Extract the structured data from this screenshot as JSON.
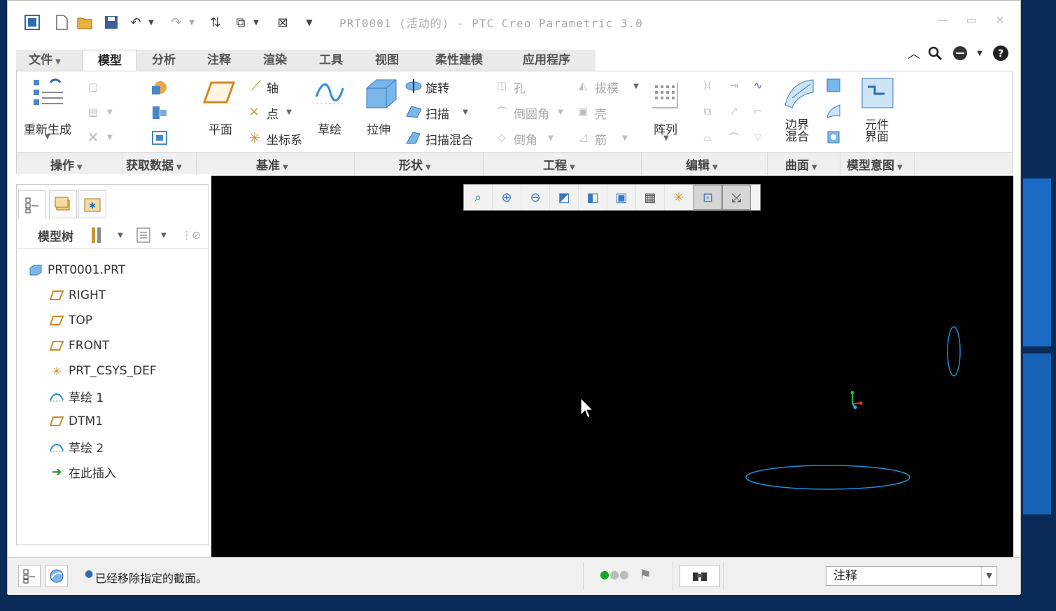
{
  "window": {
    "title": "PRT0001 (活动的) - PTC Creo Parametric 3.0"
  },
  "quick_access": [
    "new-icon",
    "open-icon",
    "save-icon",
    "undo-icon",
    "redo-icon",
    "regenerate-icon",
    "windows-icon",
    "close-window-icon",
    "customize-icon"
  ],
  "tabs": [
    {
      "label": "文件"
    },
    {
      "label": "模型"
    },
    {
      "label": "分析"
    },
    {
      "label": "注释"
    },
    {
      "label": "渲染"
    },
    {
      "label": "工具"
    },
    {
      "label": "视图"
    },
    {
      "label": "柔性建模"
    },
    {
      "label": "应用程序"
    }
  ],
  "active_tab": "模型",
  "ribbon": {
    "operations": {
      "regenerate": "重新生成"
    },
    "datum": {
      "plane": "平面",
      "axis": "轴",
      "point": "点",
      "csys": "坐标系",
      "sketch": "草绘"
    },
    "shapes": {
      "extrude": "拉伸",
      "revolve": "旋转",
      "sweep": "扫描",
      "swept_blend": "扫描混合"
    },
    "engineering": {
      "hole": "孔",
      "round": "倒圆角",
      "chamfer": "倒角",
      "draft": "拔模",
      "shell": "壳",
      "rib": "筋"
    },
    "editing": {
      "pattern": "阵列"
    },
    "surfaces": {
      "boundary_blend": "边界\n混合"
    },
    "model_intent": {
      "component_interface": "元件\n界面"
    },
    "groups": [
      "操作",
      "获取数据",
      "基准",
      "形状",
      "工程",
      "编辑",
      "曲面",
      "模型意图"
    ]
  },
  "model_tree": {
    "header_label": "模型树",
    "nodes": [
      {
        "label": "PRT0001.PRT",
        "icon": "part-icon"
      },
      {
        "label": "RIGHT",
        "icon": "datum-plane-icon"
      },
      {
        "label": "TOP",
        "icon": "datum-plane-icon"
      },
      {
        "label": "FRONT",
        "icon": "datum-plane-icon"
      },
      {
        "label": "PRT_CSYS_DEF",
        "icon": "csys-icon"
      },
      {
        "label": "草绘 1",
        "icon": "sketch-icon"
      },
      {
        "label": "DTM1",
        "icon": "datum-plane-icon"
      },
      {
        "label": "草绘 2",
        "icon": "sketch-icon"
      },
      {
        "label": "在此插入",
        "icon": "insert-here-icon"
      }
    ]
  },
  "viewport_toolbar": [
    "refit-icon",
    "zoom-in-icon",
    "zoom-out-icon",
    "repaint-icon",
    "display-style-icon",
    "saved-orientations-icon",
    "view-manager-icon",
    "datum-display-icon",
    "spin-center-icon",
    "annotation-display-icon"
  ],
  "status": {
    "message": "已经移除指定的截面。",
    "filter_value": "注释"
  },
  "colors": {
    "sketch_curve": "#1a8fd6",
    "viewport_bg": "#000000"
  }
}
